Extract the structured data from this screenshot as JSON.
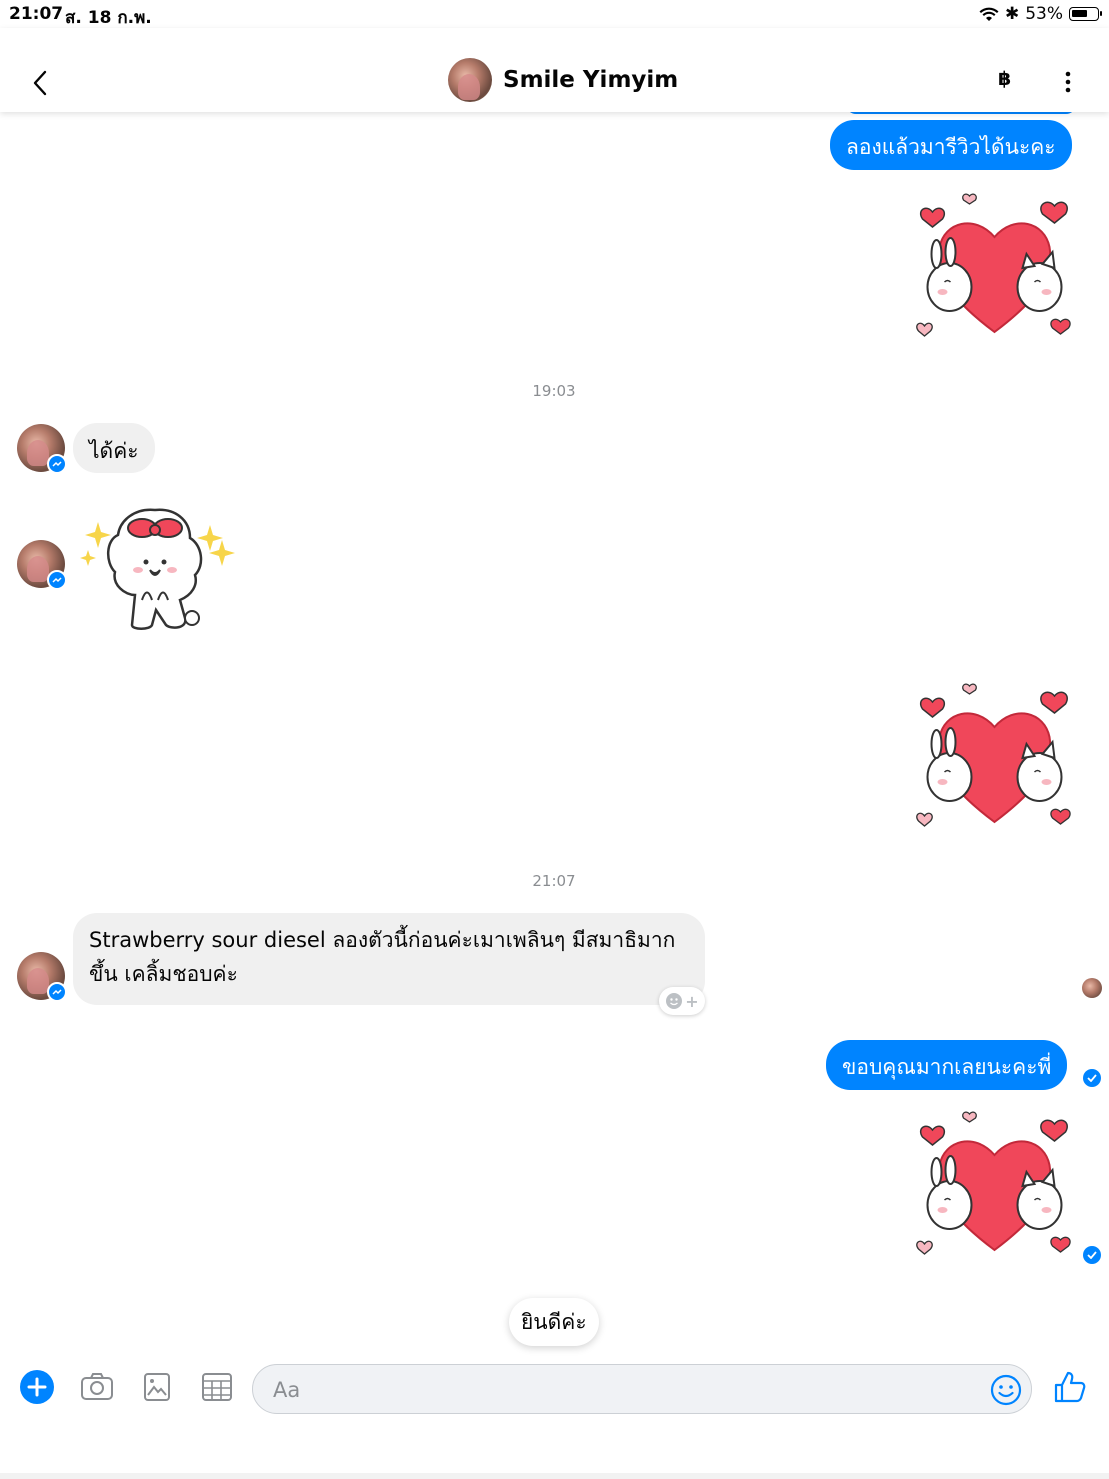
{
  "status_bar": {
    "time": "21:07",
    "date": "ส. 18 ก.พ.",
    "battery": "53%",
    "battery_level": 0.53
  },
  "header": {
    "title": "Smile Yimyim",
    "currency_symbol": "฿"
  },
  "messages": {
    "out_1": "ลองแล้วมารีวิวได้นะคะ",
    "time_1": "19:03",
    "in_1": "ได้ค่ะ",
    "time_2": "21:07",
    "in_2": "Strawberry sour diesel ลองตัวนี้ก่อนค่ะเมาเพลินๆ มีสมาธิมากขึ้น เคลิ้มชอบค่ะ",
    "out_2": "ขอบคุณมากเลยนะคะพี่"
  },
  "quick_reply": {
    "label": "ยินดีค่ะ"
  },
  "composer": {
    "placeholder": "Aa"
  },
  "colors": {
    "accent": "#0084ff",
    "bubble_in": "#f0f0f0",
    "heart": "#f0475a"
  }
}
